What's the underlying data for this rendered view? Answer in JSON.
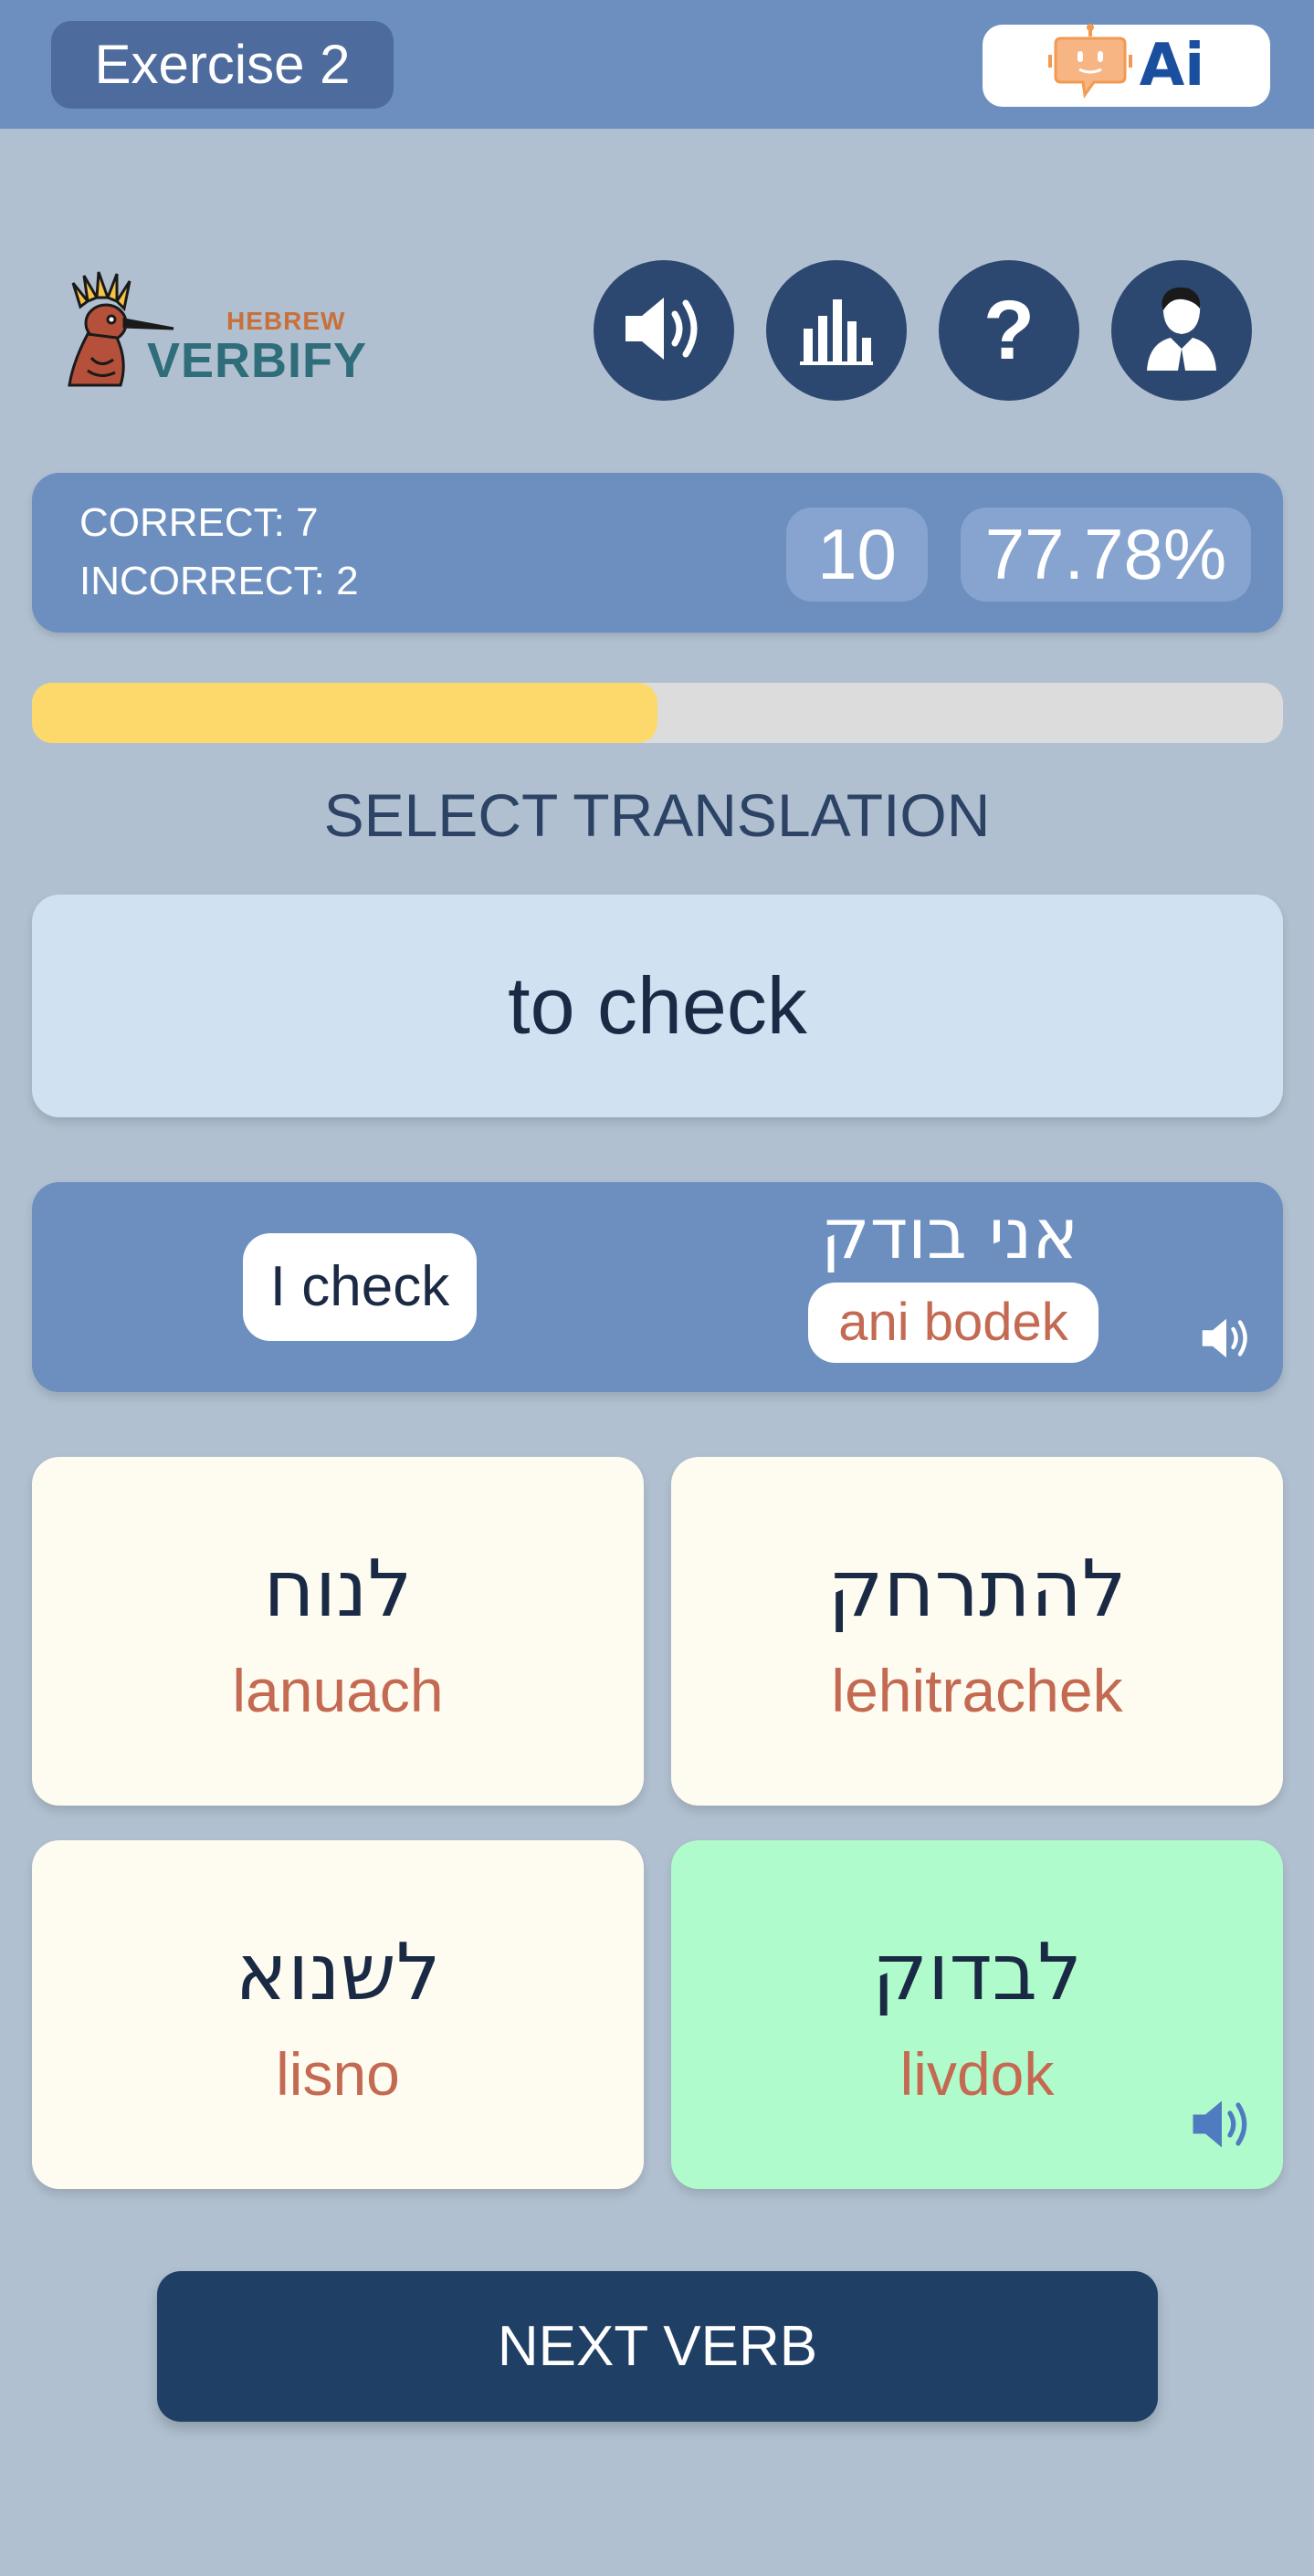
{
  "header": {
    "exercise_label": "Exercise 2",
    "ai_button_label": "Ai"
  },
  "logo": {
    "small_text": "HEBREW",
    "large_text": "VERBIFY"
  },
  "toolbar": {
    "buttons": [
      {
        "icon": "speaker-icon"
      },
      {
        "icon": "bar-chart-icon"
      },
      {
        "icon": "help-icon",
        "label": "?"
      },
      {
        "icon": "user-profile-icon"
      }
    ]
  },
  "score": {
    "correct_text": "CORRECT: 7",
    "incorrect_text": "INCORRECT: 2",
    "total": "10",
    "percentage": "77.78%"
  },
  "progress": {
    "fraction": 0.5
  },
  "prompt": {
    "instruction": "SELECT TRANSLATION",
    "english_verb": "to check"
  },
  "example": {
    "english": "I check",
    "hebrew": "אני בודק",
    "transliteration": "ani bodek"
  },
  "options": [
    {
      "hebrew": "לנוח",
      "transliteration": "lanuach",
      "state": "default"
    },
    {
      "hebrew": "להתרחק",
      "transliteration": "lehitrachek",
      "state": "default"
    },
    {
      "hebrew": "לשנוא",
      "transliteration": "lisno",
      "state": "default"
    },
    {
      "hebrew": "לבדוק",
      "transliteration": "livdok",
      "state": "correct"
    }
  ],
  "actions": {
    "next_label": "NEXT VERB"
  },
  "colors": {
    "background": "#b0c0d0",
    "header": "#6c8fbf",
    "dark_navy": "#2c4870",
    "progress_fill": "#fcd96a",
    "correct_option": "#b0fbcc",
    "transliteration": "#c46a52"
  }
}
